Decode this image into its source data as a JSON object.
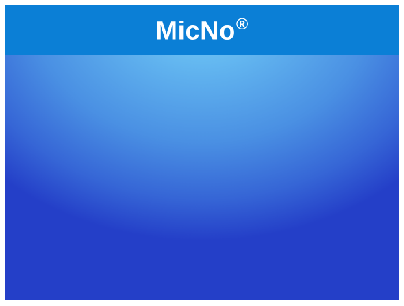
{
  "slide": {
    "title": "MicNo",
    "title_mark": "®"
  },
  "colors": {
    "title_bar": "#0b7fd6",
    "background_center": "#79d6fb",
    "background_edge": "#243fc8",
    "title_text": "#ffffff"
  }
}
